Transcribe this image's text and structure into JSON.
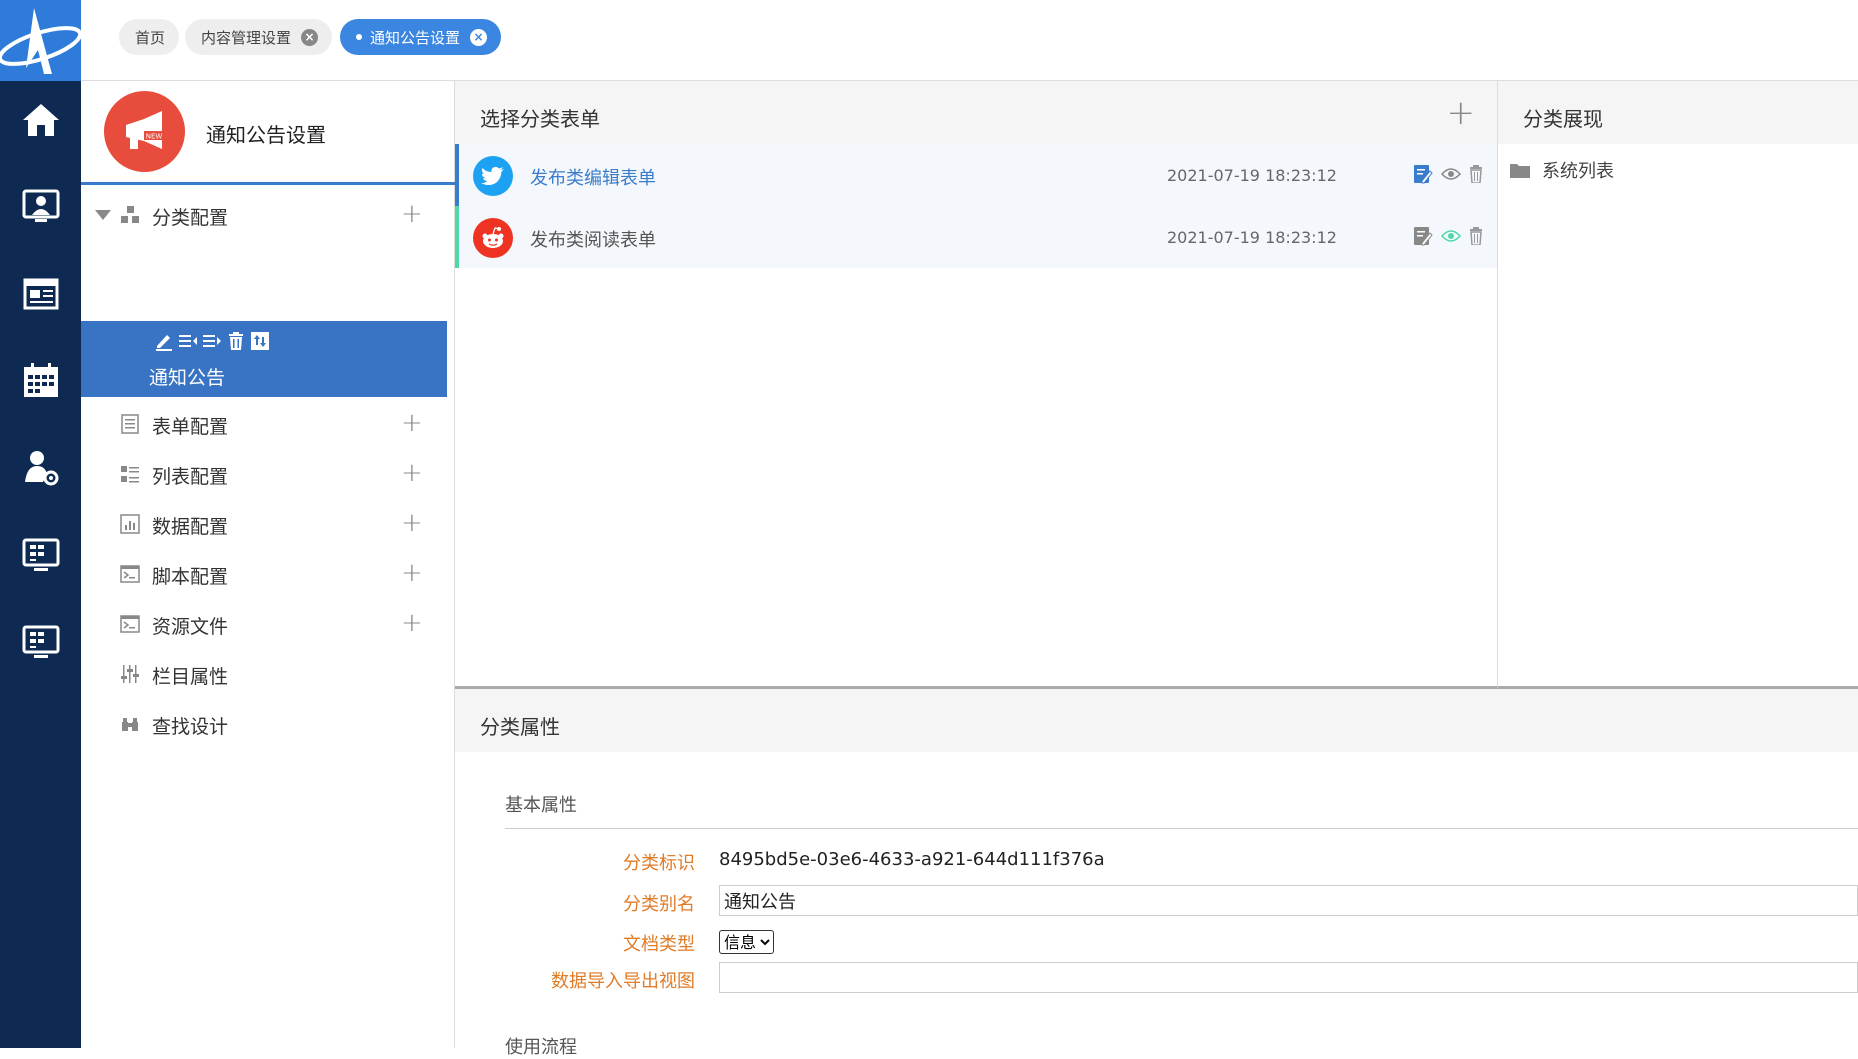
{
  "tabs": [
    {
      "label": "首页",
      "closable": false,
      "active": false
    },
    {
      "label": "内容管理设置",
      "closable": true,
      "active": false
    },
    {
      "label": "通知公告设置",
      "closable": true,
      "active": true
    }
  ],
  "nav": {
    "title": "通知公告设置",
    "avatar_badge": "NEW",
    "category_config": "分类配置",
    "selected_category": "通知公告",
    "items": [
      {
        "label": "表单配置",
        "icon": "form-icon",
        "has_add": true
      },
      {
        "label": "列表配置",
        "icon": "list-icon",
        "has_add": true
      },
      {
        "label": "数据配置",
        "icon": "chart-icon",
        "has_add": true
      },
      {
        "label": "脚本配置",
        "icon": "terminal-icon",
        "has_add": true
      },
      {
        "label": "资源文件",
        "icon": "terminal-icon",
        "has_add": true
      },
      {
        "label": "栏目属性",
        "icon": "sliders-icon",
        "has_add": false
      },
      {
        "label": "查找设计",
        "icon": "binoculars-icon",
        "has_add": false
      }
    ]
  },
  "forms": {
    "title": "选择分类表单",
    "rows": [
      {
        "name": "发布类编辑表单",
        "time": "2021-07-19 18:23:12",
        "icon": "twitter-icon",
        "accent": "#1da1f2",
        "bar": "#3a7ccc",
        "name_color": "#3a7ccc"
      },
      {
        "name": "发布类阅读表单",
        "time": "2021-07-19 18:23:12",
        "icon": "reddit-icon",
        "accent": "#ee3322",
        "bar": "#4ed8a8",
        "name_color": "#555555"
      }
    ]
  },
  "display": {
    "title": "分类展现",
    "item": "系统列表"
  },
  "props": {
    "title": "分类属性",
    "section": "基本属性",
    "id_label": "分类标识",
    "id_value": "8495bd5e-03e6-4633-a921-644d111f376a",
    "alias_label": "分类别名",
    "alias_value": "通知公告",
    "doctype_label": "文档类型",
    "doctype_value": "信息",
    "view_label": "数据导入导出视图",
    "view_value": "",
    "next_section": "使用流程"
  },
  "colors": {
    "rail": "#0e2a52",
    "brand": "#2f7bd9",
    "selected": "#3874c3",
    "label": "#e07b26"
  }
}
